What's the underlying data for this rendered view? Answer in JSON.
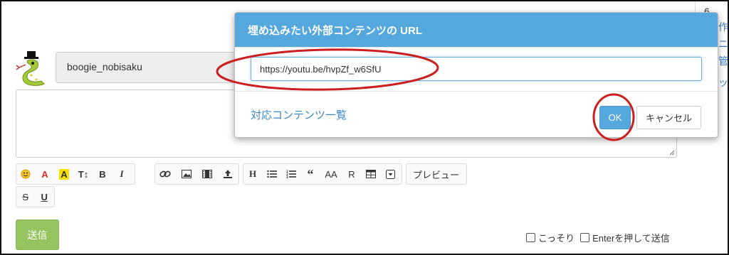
{
  "sidebar_fragment": {
    "lines": [
      "6.",
      "作",
      "ニ",
      "管",
      "ッ"
    ]
  },
  "user": {
    "name": "boogie_nobisaku"
  },
  "message": {
    "value": ""
  },
  "toolbar": {
    "group1": [
      {
        "icon": "smiley-icon",
        "glyph": "😄"
      },
      {
        "icon": "font-color-icon",
        "glyph": "A"
      },
      {
        "icon": "highlight-icon",
        "glyph": "A"
      },
      {
        "icon": "font-size-icon",
        "glyph": "T↕"
      },
      {
        "icon": "bold-icon",
        "glyph": "B"
      },
      {
        "icon": "italic-icon",
        "glyph": "I"
      }
    ],
    "group2": [
      {
        "icon": "link-icon",
        "glyph": "🔗"
      },
      {
        "icon": "image-icon",
        "glyph": "▣"
      },
      {
        "icon": "film-icon",
        "glyph": "▦"
      },
      {
        "icon": "upload-icon",
        "glyph": "↥"
      }
    ],
    "group3": [
      {
        "icon": "heading-icon",
        "glyph": "H"
      },
      {
        "icon": "bullet-list-icon",
        "glyph": "≡"
      },
      {
        "icon": "numbered-list-icon",
        "glyph": "≡"
      },
      {
        "icon": "quote-icon",
        "glyph": "“"
      },
      {
        "icon": "aa-icon",
        "glyph": "AA"
      },
      {
        "icon": "ruby-icon",
        "glyph": "R"
      },
      {
        "icon": "table-icon",
        "glyph": "⊞"
      },
      {
        "icon": "dropdown-icon",
        "glyph": "▼"
      }
    ],
    "preview_label": "プレビュー",
    "row2": [
      {
        "icon": "strikethrough-icon",
        "glyph": "S"
      },
      {
        "icon": "underline-icon",
        "glyph": "U"
      }
    ]
  },
  "send": {
    "label": "送信"
  },
  "options": {
    "secret_label": "こっそり",
    "enter_label": "Enterを押して送信"
  },
  "modal": {
    "title": "埋め込みたい外部コンテンツの URL",
    "url_value": "https://youtu.be/hvpZf_w6SfU",
    "support_link": "対応コンテンツ一覧",
    "ok_label": "OK",
    "cancel_label": "キャンセル"
  },
  "colors": {
    "modal_header": "#55a8dd",
    "send_button": "#97c460",
    "annotation": "#cc1f1f",
    "link": "#3a87c7"
  }
}
